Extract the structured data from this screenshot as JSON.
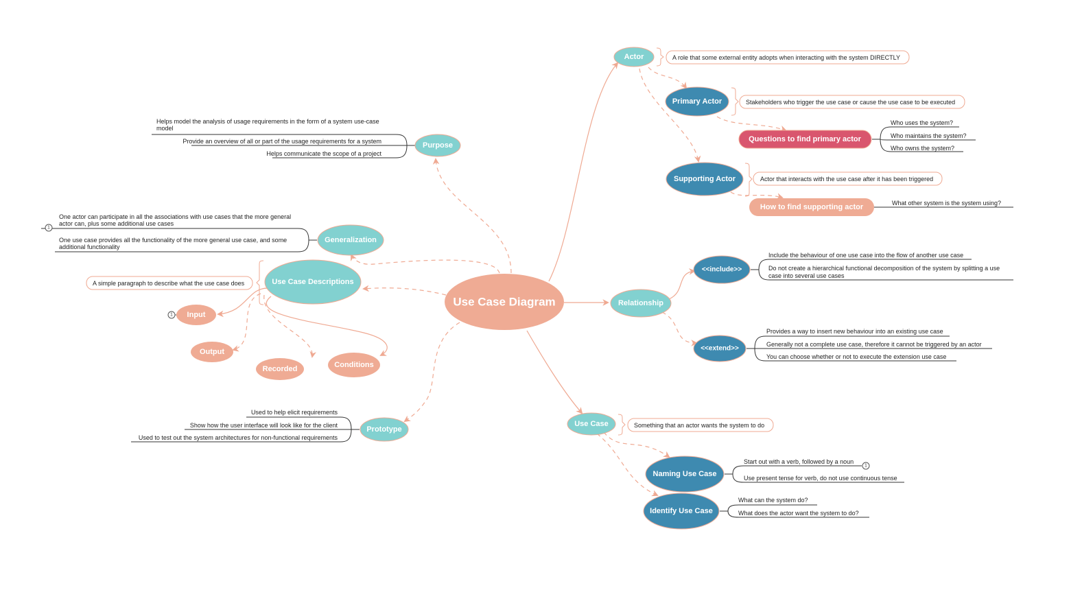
{
  "title": "Use Case Diagram",
  "colors": {
    "central": "#EFAB94",
    "teal": "#82D1D0",
    "blue": "#3E8AB0",
    "red": "#D9566E",
    "salmon": "#EFAB94",
    "connector": "#EFA992",
    "leaf_line": "#333333"
  },
  "nodes": {
    "central": "Use Case Diagram",
    "purpose": "Purpose",
    "generalization": "Generalization",
    "use_case_descriptions": "Use Case Descriptions",
    "input": "Input",
    "output": "Output",
    "recorded": "Recorded",
    "conditions": "Conditions",
    "prototype": "Prototype",
    "actor": "Actor",
    "primary_actor": "Primary Actor",
    "questions_primary": "Questions to find primary actor",
    "supporting_actor": "Supporting Actor",
    "how_supporting": "How to find supporting actor",
    "relationship": "Relationship",
    "include": "<<include>>",
    "extend": "<<extend>>",
    "use_case": "Use Case",
    "naming_use_case": "Naming Use Case",
    "identify_use_case": "Identify Use Case"
  },
  "notes": {
    "actor": "A role that some external entity adopts when interacting with the system DIRECTLY",
    "primary_actor": "Stakeholders who trigger the use case or cause the use case to be executed",
    "supporting_actor": "Actor that interacts with the use case after it has been triggered",
    "use_case_descriptions": "A simple paragraph to describe what the use case does",
    "use_case": "Something that an actor wants the system to do"
  },
  "leaves": {
    "purpose": [
      [
        "Helps model the analysis of usage requirements in the form of a system use-case",
        "model"
      ],
      [
        "Provide an overview of all or part of the usage requirements  for a system"
      ],
      [
        "Helps communicate the scope of a project"
      ]
    ],
    "generalization": [
      [
        "One actor can participate in all the associations with use cases that the more general",
        "actor can, plus some additional use cases"
      ],
      [
        "One use case provides all the functionality of the more general use case, and some",
        "additional functionality"
      ]
    ],
    "prototype": [
      [
        "Used to help elicit requirements"
      ],
      [
        "Show how the user interface will look like for the client"
      ],
      [
        "Used to test out the system architectures for non-functional requirements"
      ]
    ],
    "questions_primary": [
      [
        "Who uses the system?"
      ],
      [
        "Who maintains the system?"
      ],
      [
        "Who owns the system?"
      ]
    ],
    "how_supporting": [
      [
        "What other system is the system using?"
      ]
    ],
    "include": [
      [
        "Include the behaviour of one use case into the flow of another use case"
      ],
      [
        "Do not create a hierarchical functional decomposition of the system by splitting a use",
        "case into several use cases"
      ]
    ],
    "extend": [
      [
        "Provides a way to insert new behaviour into an existing use case"
      ],
      [
        "Generally not a complete use case, therefore it cannot be triggered by an actor"
      ],
      [
        "You can choose whether or not to execute the extension use case"
      ]
    ],
    "naming_use_case": [
      [
        "Start out with a verb, followed by a noun"
      ],
      [
        "Use present tense for verb, do not use continuous tense"
      ]
    ],
    "identify_use_case": [
      [
        "What can the system do?"
      ],
      [
        "What does the actor want the system to do?"
      ]
    ]
  },
  "badges": {
    "generalization_first": "1",
    "input": "1",
    "naming_first": "1"
  }
}
